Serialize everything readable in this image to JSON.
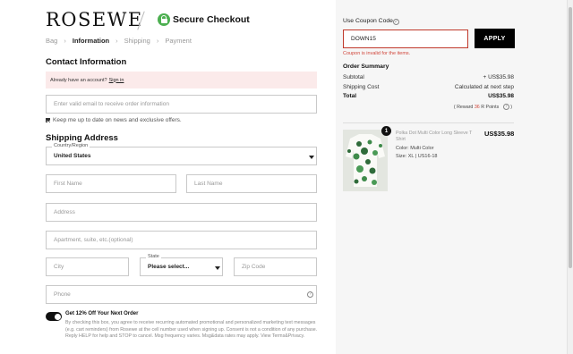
{
  "brand": {
    "logo_text": "ROSEWE",
    "secure_title": "Secure Checkout"
  },
  "breadcrumb": {
    "items": [
      "Bag",
      "Information",
      "Shipping",
      "Payment"
    ],
    "current_index": 1
  },
  "contact": {
    "heading": "Contact Information",
    "account_prompt": "Already have an account?",
    "signin_link": "Sign in",
    "email_placeholder": "Enter valid email to receive order information",
    "newsletter_label": "Keep me up to date on news and exclusive offers.",
    "newsletter_checked": true
  },
  "shipping": {
    "heading": "Shipping Address",
    "country_label": "Country/Region",
    "country_value": "United States",
    "first_name_placeholder": "First Name",
    "last_name_placeholder": "Last Name",
    "address_placeholder": "Address",
    "apartment_placeholder": "Apartment, suite, etc.(optional)",
    "city_placeholder": "City",
    "state_label": "State",
    "state_value": "Please select...",
    "zip_placeholder": "Zip Code",
    "phone_placeholder": "Phone"
  },
  "sms_offer": {
    "enabled": true,
    "title": "Get 12% Off Your Next Order",
    "text": "By checking this box, you agree to receive recurring automated promotional and personalized marketing text messages (e.g. cart reminders) from Rosewe at the cell number used when signing up. Consent is not a condition of any purchase. Reply HELP for help and STOP to cancel. Msg frequency varies. Msg&data rates may apply. View Terms&Privacy."
  },
  "coupon": {
    "label": "Use Coupon Code :",
    "value": "DOWN15",
    "apply_label": "APPLY",
    "error": "Coupon is invalid for the items."
  },
  "summary": {
    "heading": "Order Summary",
    "subtotal_label": "Subtotal",
    "subtotal_value": "+ US$35.98",
    "shipping_label": "Shipping Cost",
    "shipping_value": "Calculated at next step",
    "total_label": "Total",
    "total_value": "US$35.98",
    "reward_prefix": "( Reward",
    "reward_points": "36",
    "reward_suffix": "R Points"
  },
  "cart_item": {
    "quantity": "1",
    "name": "Polka Dot Multi Color Long Sleeve T Shirt",
    "color": "Color: Multi Color",
    "size": "Size: XL | US16-18",
    "price": "US$35.98"
  },
  "colors": {
    "accent": "#000000",
    "error": "#d0453a",
    "sidebar_bg": "#f6f6f6",
    "lock_green": "#4caf50",
    "account_box_bg": "#fbeaea"
  },
  "icons": [
    "lock-icon",
    "chevron-right-icon",
    "checkbox-icon",
    "dropdown-caret-icon",
    "help-icon",
    "toggle-icon"
  ]
}
